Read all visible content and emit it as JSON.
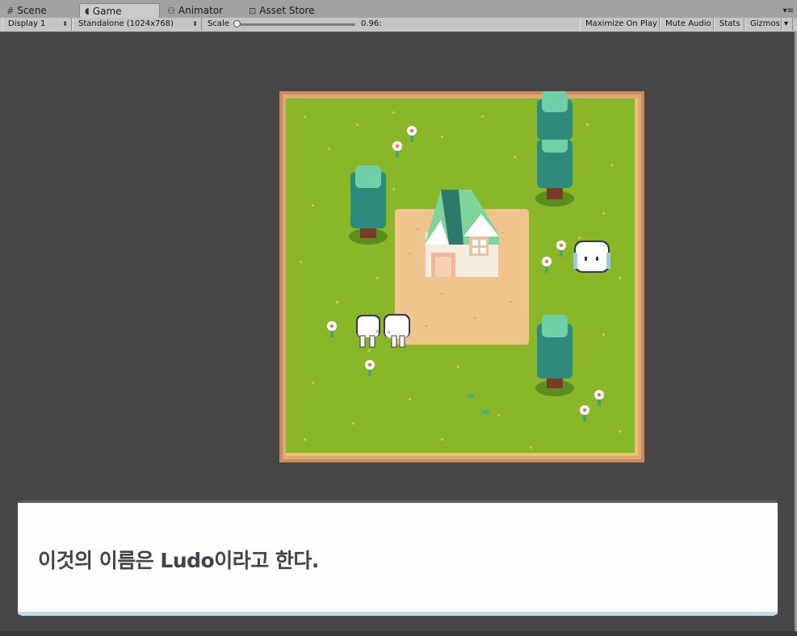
{
  "tabs": [
    {
      "label": "Scene",
      "icon": "grid-icon"
    },
    {
      "label": "Game",
      "icon": "pacman-icon"
    },
    {
      "label": "Animator",
      "icon": "nodes-icon"
    },
    {
      "label": "Asset Store",
      "icon": "bag-icon"
    }
  ],
  "toolbar": {
    "display": "Display 1",
    "resolution": "Standalone (1024x768)",
    "scale_label": "Scale",
    "scale_value": "0.96:",
    "maximize": "Maximize On Play",
    "mute": "Mute Audio",
    "stats": "Stats",
    "gizmos": "Gizmos"
  },
  "dialog": {
    "text": "이것의 이름은 Ludo이라고 한다."
  },
  "colors": {
    "grass": "#8ab72a",
    "border": "#c9895c",
    "dirt": "#efc48d",
    "tree": "#2e8a7a",
    "roof": "#7fd39b",
    "editor_bg": "#464646"
  }
}
